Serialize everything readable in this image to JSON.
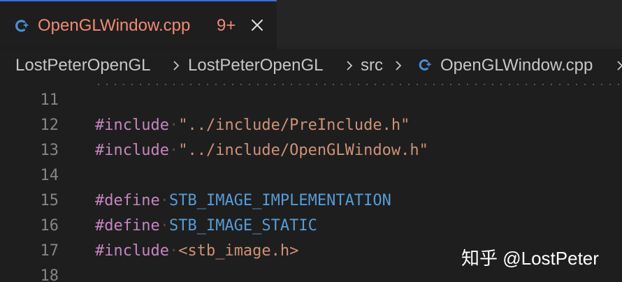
{
  "tab": {
    "title": "OpenGLWindow.cpp",
    "badge": "9+",
    "icon": "cpp-file-icon",
    "close_icon": "close-icon"
  },
  "breadcrumb": {
    "items": [
      "LostPeterOpenGL",
      "LostPeterOpenGL",
      "src",
      "OpenGLWindow.cpp"
    ],
    "separator_icon": "chevron-right-icon"
  },
  "colors": {
    "accent": "#3a6fd8",
    "tab_title": "#f08a74",
    "keyword": "#c586c0",
    "string": "#ce9178",
    "macro": "#569cd6",
    "line_number": "#858585"
  },
  "editor": {
    "lines": [
      {
        "num": "11",
        "kw": "",
        "ws": "",
        "arg": ""
      },
      {
        "num": "12",
        "kw": "#include",
        "ws": "·",
        "arg": "\"../include/PreInclude.h\""
      },
      {
        "num": "13",
        "kw": "#include",
        "ws": "·",
        "arg": "\"../include/OpenGLWindow.h\""
      },
      {
        "num": "14",
        "kw": "",
        "ws": "",
        "arg": ""
      },
      {
        "num": "15",
        "kw": "#define",
        "ws": "·",
        "arg": "STB_IMAGE_IMPLEMENTATION"
      },
      {
        "num": "16",
        "kw": "#define",
        "ws": "·",
        "arg": "STB_IMAGE_STATIC"
      },
      {
        "num": "17",
        "kw": "#include",
        "ws": "·",
        "arg": "<stb_image.h>"
      },
      {
        "num": "18",
        "kw": "",
        "ws": "",
        "arg": ""
      }
    ]
  },
  "watermark": "知乎 @LostPeter"
}
